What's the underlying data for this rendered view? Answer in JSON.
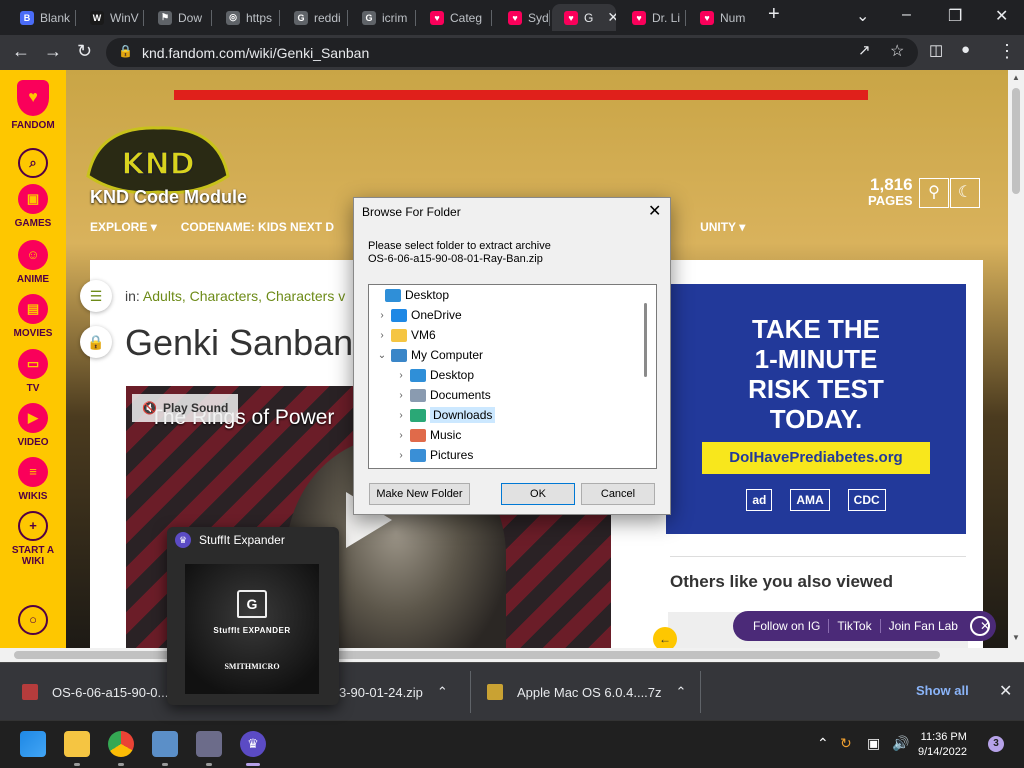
{
  "tabs": [
    {
      "label": "Blank",
      "color": "#4a6cf7",
      "glyph": "B",
      "icon": "blank-favicon-icon"
    },
    {
      "label": "WinV",
      "color": "#1a1a1a",
      "glyph": "W",
      "icon": "winv-favicon-icon"
    },
    {
      "label": "Dow",
      "color": "#5f6368",
      "glyph": "⚑",
      "icon": "download-favicon-icon"
    },
    {
      "label": "https",
      "color": "#5f6368",
      "glyph": "◎",
      "icon": "globe-icon"
    },
    {
      "label": "reddi",
      "color": "#5f6368",
      "glyph": "G",
      "icon": "google-icon"
    },
    {
      "label": "icrim",
      "color": "#5f6368",
      "glyph": "G",
      "icon": "google-icon"
    },
    {
      "label": "Categ",
      "color": "#fa005a",
      "glyph": "♥",
      "icon": "fandom-icon"
    },
    {
      "label": "Sydn",
      "color": "#fa005a",
      "glyph": "♥",
      "icon": "fandom-icon"
    },
    {
      "label": "G",
      "color": "#fa005a",
      "glyph": "♥",
      "icon": "fandom-icon",
      "active": true
    },
    {
      "label": "Dr. Li",
      "color": "#fa005a",
      "glyph": "♥",
      "icon": "fandom-icon"
    },
    {
      "label": "Num",
      "color": "#fa005a",
      "glyph": "♥",
      "icon": "fandom-icon"
    }
  ],
  "browser": {
    "url": "knd.fandom.com/wiki/Genki_Sanban",
    "new_tab": "+",
    "tab_close": "✕"
  },
  "fandom_sidebar": [
    {
      "label": "FANDOM",
      "glyph": "♥",
      "icon": "fandom-logo-icon"
    },
    {
      "label": "",
      "glyph": "⌕",
      "icon": "search-icon"
    },
    {
      "label": "GAMES",
      "glyph": "▣",
      "icon": "games-icon"
    },
    {
      "label": "ANIME",
      "glyph": "☺",
      "icon": "anime-icon"
    },
    {
      "label": "MOVIES",
      "glyph": "▤",
      "icon": "movies-icon"
    },
    {
      "label": "TV",
      "glyph": "▭",
      "icon": "tv-icon"
    },
    {
      "label": "VIDEO",
      "glyph": "▶",
      "icon": "video-icon"
    },
    {
      "label": "WIKIS",
      "glyph": "≡",
      "icon": "wikis-icon"
    },
    {
      "label": "START A WIKI",
      "glyph": "+",
      "icon": "start-a-wiki-icon"
    },
    {
      "label": "",
      "glyph": "○",
      "icon": "account-icon"
    }
  ],
  "wiki": {
    "name": "KND Code Module",
    "logo_text": "KND",
    "nav": [
      "EXPLORE",
      "CODENAME: KIDS NEXT D",
      "UNITY"
    ],
    "pages_count": "1,816",
    "pages_label": "PAGES"
  },
  "article": {
    "breadcrumb_prefix": "in:",
    "breadcrumb": "Adults, Characters, Characters v",
    "title": "Genki Sanban",
    "video_caption": "The Rings of Power",
    "play_sound": "Play Sound"
  },
  "ad": {
    "headline": [
      "TAKE THE",
      "1-MINUTE",
      "RISK TEST",
      "TODAY."
    ],
    "url": "DoIHavePrediabetes.org",
    "logos": [
      "ad",
      "AMA",
      "CDC"
    ]
  },
  "sidebar_section": {
    "others_title": "Others like you also viewed"
  },
  "social_bar": {
    "items": [
      "Follow on IG",
      "TikTok",
      "Join Fan Lab"
    ]
  },
  "dialog": {
    "title": "Browse For Folder",
    "message_line1": "Please select folder to extract archive",
    "message_line2": "OS-6-06-a15-90-08-01-Ray-Ban.zip",
    "tree": [
      {
        "label": "Desktop",
        "level": 0,
        "expander": "",
        "color": "#2f8fd8",
        "icon": "desktop-folder-icon"
      },
      {
        "label": "OneDrive",
        "level": 1,
        "expander": "›",
        "color": "#1e88e5",
        "icon": "onedrive-icon"
      },
      {
        "label": "VM6",
        "level": 1,
        "expander": "›",
        "color": "#f5c542",
        "icon": "folder-icon"
      },
      {
        "label": "My Computer",
        "level": 1,
        "expander": "⌄",
        "color": "#3a86c8",
        "icon": "computer-icon"
      },
      {
        "label": "Desktop",
        "level": 2,
        "expander": "›",
        "color": "#2f8fd8",
        "icon": "desktop-folder-icon"
      },
      {
        "label": "Documents",
        "level": 2,
        "expander": "›",
        "color": "#8a9bb0",
        "icon": "documents-folder-icon"
      },
      {
        "label": "Downloads",
        "level": 2,
        "expander": "›",
        "color": "#2aa876",
        "icon": "downloads-folder-icon",
        "selected": true
      },
      {
        "label": "Music",
        "level": 2,
        "expander": "›",
        "color": "#e06a4a",
        "icon": "music-folder-icon"
      },
      {
        "label": "Pictures",
        "level": 2,
        "expander": "›",
        "color": "#3a8fd6",
        "icon": "pictures-folder-icon"
      }
    ],
    "make_new_folder": "Make New Folder",
    "ok": "OK",
    "cancel": "Cancel"
  },
  "stuffit": {
    "title": "StuffIt Expander",
    "product": "StuffIt EXPANDER",
    "vendor": "SMITHMICRO"
  },
  "downloads": {
    "items": [
      {
        "name": "OS-6-06-a15-90-0...."
      },
      {
        "name": "3-90-01-24.zip"
      },
      {
        "name": "Apple Mac OS 6.0.4....7z"
      }
    ],
    "show_all": "Show all"
  },
  "taskbar": {
    "time": "11:36 PM",
    "date": "9/14/2022",
    "notifications": "3",
    "apps": [
      "start-icon",
      "file-explorer-icon",
      "chrome-icon",
      "photos-icon",
      "winrar-icon",
      "stuffit-taskbar-icon"
    ]
  }
}
